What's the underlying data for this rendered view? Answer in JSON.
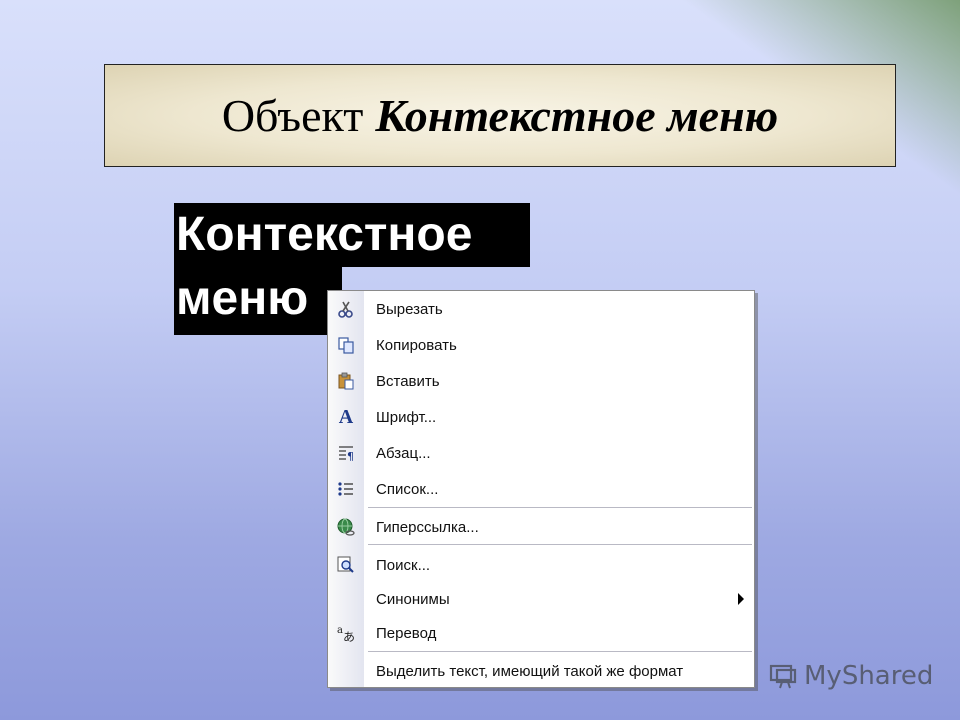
{
  "slide": {
    "title_plain": "Объект",
    "title_emphasis": "Контекстное меню",
    "selected_text_line1": "Контекстное",
    "selected_text_line2": "меню"
  },
  "context_menu": {
    "items": [
      {
        "label": "Вырезать",
        "icon": "scissors-icon"
      },
      {
        "label": "Копировать",
        "icon": "copy-icon"
      },
      {
        "label": "Вставить",
        "icon": "paste-icon"
      },
      {
        "label": "Шрифт...",
        "icon": "font-icon"
      },
      {
        "label": "Абзац...",
        "icon": "paragraph-icon"
      },
      {
        "label": "Список...",
        "icon": "bullet-list-icon"
      },
      {
        "label": "Гиперссылка...",
        "icon": "hyperlink-globe-icon"
      },
      {
        "label": "Поиск...",
        "icon": "search-icon"
      },
      {
        "label": "Синонимы",
        "icon": "none",
        "has_submenu": true
      },
      {
        "label": "Перевод",
        "icon": "translate-icon"
      },
      {
        "label": "Выделить текст, имеющий такой же формат",
        "icon": "none"
      }
    ]
  },
  "watermark": {
    "text": "MyShared"
  },
  "colors": {
    "title_box_bg": "#eee7d0",
    "selection_bg": "#000000",
    "menu_bg": "#ffffff",
    "gutter_bg": "#e3e5f0"
  }
}
